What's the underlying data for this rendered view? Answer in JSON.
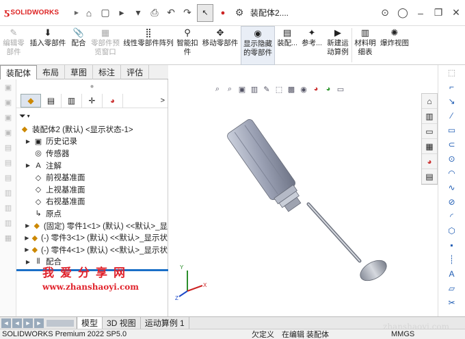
{
  "app": {
    "logo_ds": "ƽ",
    "logo_text": "SOLIDWORKS",
    "window_title": "装配体2...."
  },
  "toolbar": {
    "home": "⌂",
    "new": "▢",
    "open": "▸",
    "save": "▾",
    "print": "⎙",
    "undo": "↶",
    "redo": "↷",
    "select": "↖",
    "rebuild": "●",
    "options": "⚙"
  },
  "commands": [
    {
      "label1": "编辑零",
      "label2": "部件",
      "icon": "✎",
      "state": "disabled"
    },
    {
      "label1": "插入零部件",
      "label2": "",
      "icon": "⬇",
      "state": "normal"
    },
    {
      "label1": "配合",
      "label2": "",
      "icon": "📎",
      "state": "normal"
    },
    {
      "label1": "零部件预",
      "label2": "览窗口",
      "icon": "▦",
      "state": "disabled"
    },
    {
      "label1": "线性零部件阵列",
      "label2": "",
      "icon": "⣿",
      "state": "normal"
    },
    {
      "label1": "智能扣",
      "label2": "件",
      "icon": "⚲",
      "state": "normal"
    },
    {
      "label1": "移动零部件",
      "label2": "",
      "icon": "✥",
      "state": "normal"
    },
    {
      "label1": "显示隐藏",
      "label2": "的零部件",
      "icon": "◉",
      "state": "active"
    },
    {
      "label1": "装配...",
      "label2": "",
      "icon": "▤",
      "state": "normal"
    },
    {
      "label1": "参考...",
      "label2": "",
      "icon": "✦",
      "state": "normal"
    },
    {
      "label1": "新建运",
      "label2": "动算例",
      "icon": "▶",
      "state": "normal"
    },
    {
      "label1": "材料明",
      "label2": "细表",
      "icon": "▥",
      "state": "normal"
    },
    {
      "label1": "爆炸视图",
      "label2": "",
      "icon": "✺",
      "state": "normal"
    }
  ],
  "tabs": [
    "装配体",
    "布局",
    "草图",
    "标注",
    "评估"
  ],
  "tree": {
    "root": "装配体2 (默认) <显示状态-1>",
    "items": [
      {
        "label": "历史记录",
        "exp": "▶",
        "icon": "▣",
        "lvl": "lvl1"
      },
      {
        "label": "传感器",
        "exp": "",
        "icon": "◎",
        "lvl": "lvl1"
      },
      {
        "label": "注解",
        "exp": "▶",
        "icon": "A",
        "lvl": "lvl1"
      },
      {
        "label": "前视基准面",
        "exp": "",
        "icon": "◇",
        "lvl": "lvl1"
      },
      {
        "label": "上视基准面",
        "exp": "",
        "icon": "◇",
        "lvl": "lvl1"
      },
      {
        "label": "右视基准面",
        "exp": "",
        "icon": "◇",
        "lvl": "lvl1"
      },
      {
        "label": "原点",
        "exp": "",
        "icon": "↳",
        "lvl": "lvl1"
      },
      {
        "label": "(固定) 零件1<1> (默认) <<默认>_显",
        "exp": "▶",
        "icon": "◆",
        "lvl": "lvl1"
      },
      {
        "label": "(-) 零件3<1> (默认) <<默认>_显示状",
        "exp": "▶",
        "icon": "◆",
        "lvl": "lvl1"
      },
      {
        "label": "(-) 零件4<1> (默认) <<默认>_显示状",
        "exp": "▶",
        "icon": "◆",
        "lvl": "lvl1"
      },
      {
        "label": "配合",
        "exp": "▶",
        "icon": "⦀",
        "lvl": "lvl1"
      }
    ]
  },
  "watermark": {
    "cn": "我爱分享网",
    "url": "www.zhanshaoyi.com",
    "site": "zhanshaoyi.com"
  },
  "bottom_tabs": [
    "模型",
    "3D 视图",
    "运动算例 1"
  ],
  "status": {
    "product": "SOLIDWORKS Premium 2022 SP5.0",
    "state1": "欠定义",
    "state2": "在编辑 装配体",
    "units": "MMGS"
  },
  "colors": {
    "brand_red": "#d22222",
    "accent_blue": "#1a6fc7",
    "watermark_red": "#e0232c"
  }
}
